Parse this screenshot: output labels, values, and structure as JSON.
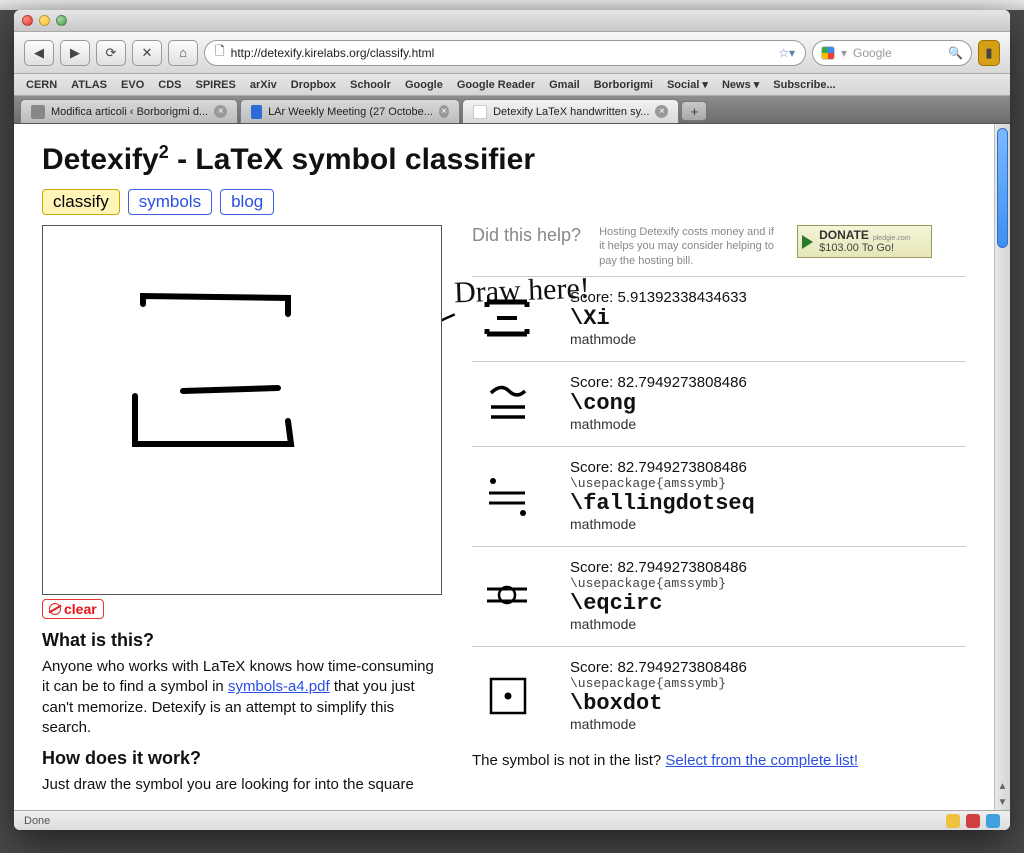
{
  "url": "http://detexify.kirelabs.org/classify.html",
  "search_placeholder": "Google",
  "bookmarks": [
    "CERN",
    "ATLAS",
    "EVO",
    "CDS",
    "SPIRES",
    "arXiv",
    "Dropbox",
    "Schoolr",
    "Google",
    "Google Reader",
    "Gmail",
    "Borborigmi",
    "Social ▾",
    "News ▾",
    "Subscribe..."
  ],
  "tabs": [
    {
      "label": "Modifica articoli ‹ Borborigmi d...",
      "active": false
    },
    {
      "label": "LAr Weekly Meeting (27 Octobe...",
      "active": false
    },
    {
      "label": "Detexify LaTeX handwritten sy...",
      "active": true
    }
  ],
  "title_pre": "Detexify",
  "title_sup": "2",
  "title_post": " - LaTeX symbol classifier",
  "nav": [
    "classify",
    "symbols",
    "blog"
  ],
  "handwrite": "Draw here!",
  "clear": "clear",
  "whatis_h": "What is this?",
  "whatis_p_a": "Anyone who works with LaTeX knows how time-consuming it can be to find a symbol in ",
  "whatis_link": "symbols-a4.pdf",
  "whatis_p_b": " that you just can't memorize. Detexify is an attempt to simplify this search.",
  "howwork_h": "How does it work?",
  "howwork_p": "Just draw the symbol you are looking for into the square",
  "help_q": "Did this help?",
  "help_note": "Hosting Detexify costs money and if it helps you may consider helping to pay the hosting bill.",
  "donate_big": "DONATE",
  "donate_src": "pledgie.com",
  "donate_sub": "$103.00 To Go!",
  "results": [
    {
      "score": "5.91392338434633",
      "pkg": "",
      "cmd": "\\Xi",
      "mode": "mathmode",
      "sym": "xi"
    },
    {
      "score": "82.7949273808486",
      "pkg": "",
      "cmd": "\\cong",
      "mode": "mathmode",
      "sym": "cong"
    },
    {
      "score": "82.7949273808486",
      "pkg": "\\usepackage{amssymb}",
      "cmd": "\\fallingdotseq",
      "mode": "mathmode",
      "sym": "fallingdotseq"
    },
    {
      "score": "82.7949273808486",
      "pkg": "\\usepackage{amssymb}",
      "cmd": "\\eqcirc",
      "mode": "mathmode",
      "sym": "eqcirc"
    },
    {
      "score": "82.7949273808486",
      "pkg": "\\usepackage{amssymb}",
      "cmd": "\\boxdot",
      "mode": "mathmode",
      "sym": "boxdot"
    }
  ],
  "notlist_a": "The symbol is not in the list? ",
  "notlist_link": "Select from the complete list!",
  "status": "Done"
}
